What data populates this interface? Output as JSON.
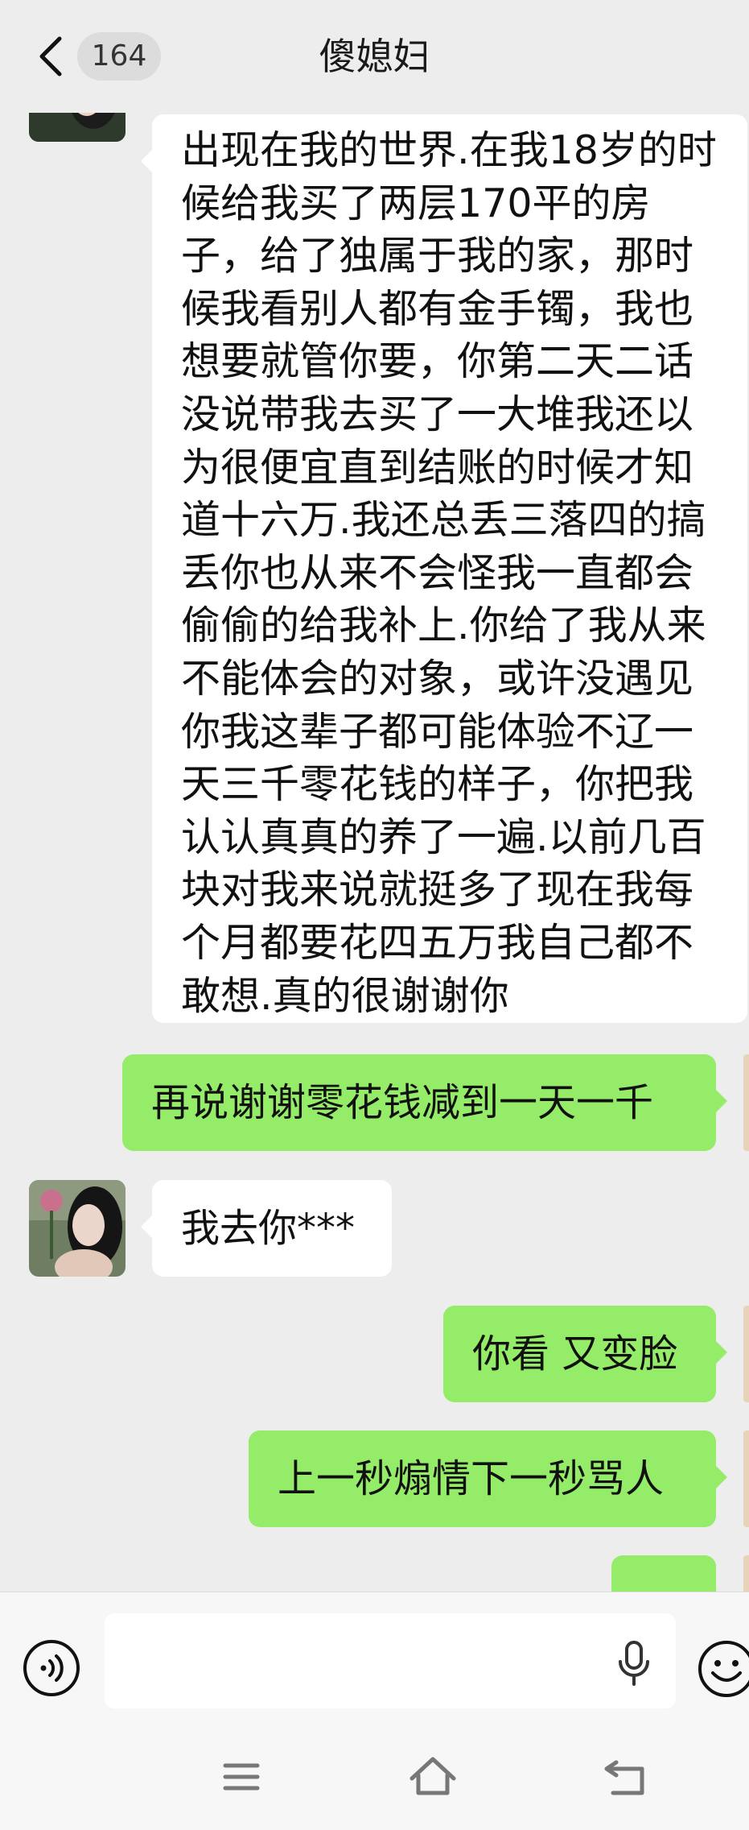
{
  "header": {
    "unread_count": "164",
    "title": "傻媳妇"
  },
  "messages": [
    {
      "side": "in",
      "text": "出现在我的世界.在我18岁的时候给我买了两层170平的房子，给了独属于我的家，那时候我看别人都有金手镯，我也想要就管你要，你第二天二话没说带我去买了一大堆我还以为很便宜直到结账的时候才知道十六万.我还总丢三落四的搞丢你也从来不会怪我一直都会偷偷的给我补上.你给了我从来不能体会的对象，或许没遇见你我这辈子都可能体验不辽一天三千零花钱的样子，你把我认认真真的养了一遍.以前几百块对我来说就挺多了现在我每个月都要花四五万我自己都不敢想.真的很谢谢你"
    },
    {
      "side": "out",
      "text": "再说谢谢零花钱减到一天一千"
    },
    {
      "side": "in",
      "text": "我去你***"
    },
    {
      "side": "out",
      "text": "你看 又变脸"
    },
    {
      "side": "out",
      "text": "上一秒煽情下一秒骂人"
    },
    {
      "side": "out",
      "text": ""
    }
  ],
  "input": {
    "placeholder": ""
  },
  "icons": {
    "back": "chevron-left-icon",
    "voice": "voice-icon",
    "mic": "mic-icon",
    "emoji": "emoji-icon",
    "nav_menu": "menu-icon",
    "nav_home": "home-icon",
    "nav_back": "back-icon"
  },
  "colors": {
    "background": "#ededed",
    "outgoing_bubble": "#95ec69",
    "incoming_bubble": "#ffffff"
  }
}
